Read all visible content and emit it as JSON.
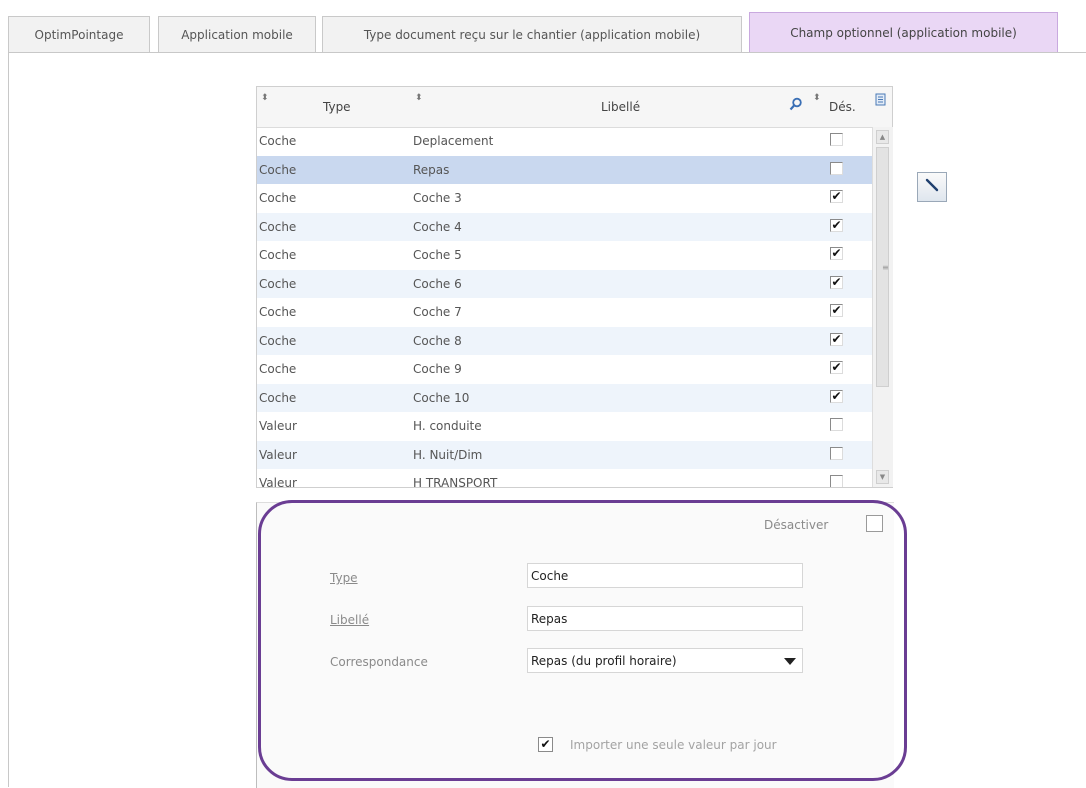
{
  "tabs": [
    {
      "label": "OptimPointage"
    },
    {
      "label": "Application mobile"
    },
    {
      "label": "Type document reçu sur le chantier (application mobile)"
    },
    {
      "label": "Champ optionnel (application mobile)"
    }
  ],
  "grid": {
    "columns": {
      "type": "Type",
      "libelle": "Libellé",
      "des": "Dés."
    },
    "rows": [
      {
        "type": "Coche",
        "libelle": "Deplacement",
        "des": false
      },
      {
        "type": "Coche",
        "libelle": "Repas",
        "des": false
      },
      {
        "type": "Coche",
        "libelle": "Coche 3",
        "des": true
      },
      {
        "type": "Coche",
        "libelle": "Coche 4",
        "des": true
      },
      {
        "type": "Coche",
        "libelle": "Coche 5",
        "des": true
      },
      {
        "type": "Coche",
        "libelle": "Coche 6",
        "des": true
      },
      {
        "type": "Coche",
        "libelle": "Coche 7",
        "des": true
      },
      {
        "type": "Coche",
        "libelle": "Coche 8",
        "des": true
      },
      {
        "type": "Coche",
        "libelle": "Coche 9",
        "des": true
      },
      {
        "type": "Coche",
        "libelle": "Coche 10",
        "des": true
      },
      {
        "type": "Valeur",
        "libelle": "H. conduite",
        "des": false
      },
      {
        "type": "Valeur",
        "libelle": "H. Nuit/Dim",
        "des": false
      },
      {
        "type": "Valeur",
        "libelle": "H TRANSPORT",
        "des": false
      }
    ]
  },
  "detail": {
    "desactiver_label": "Désactiver",
    "type_label": "Type",
    "type_value": "Coche",
    "libelle_label": "Libellé",
    "libelle_value": "Repas",
    "correspondance_label": "Correspondance",
    "correspondance_value": "Repas (du profil horaire)",
    "import_label": "Importer une seule valeur par jour",
    "import_checked": true
  },
  "icons": {
    "sort": "sort-icon",
    "search": "search-icon",
    "export": "export-icon",
    "edit": "edit-pencil-icon"
  },
  "colors": {
    "active_tab": "#ead7f5",
    "selected_row": "#c9d8ef",
    "highlight_outline": "#6a3d93"
  }
}
